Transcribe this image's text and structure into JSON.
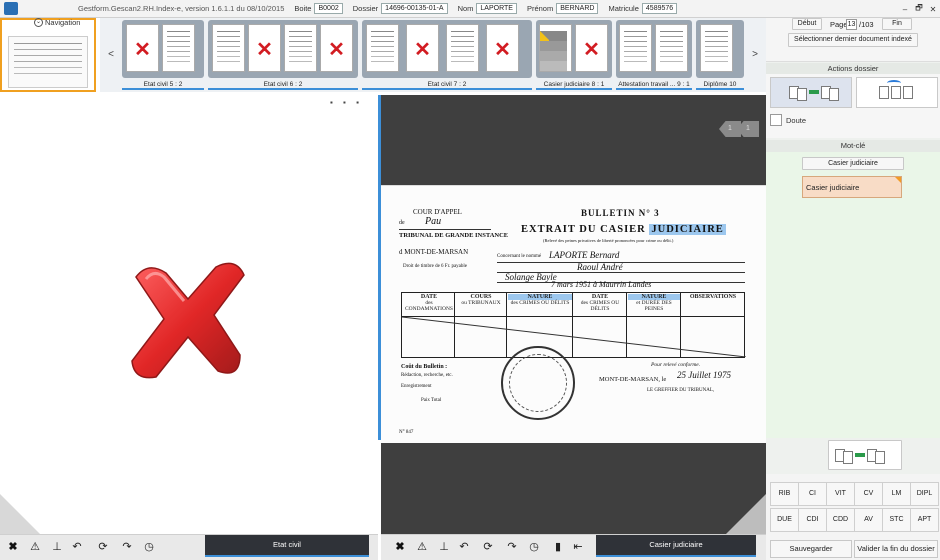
{
  "window": {
    "title": "Gestform.Gescan2.RH.Index-e, version 1.6.1.1 du 08/10/2015",
    "fields": [
      {
        "label": "Boite",
        "value": "B0002"
      },
      {
        "label": "Dossier",
        "value": "14696-00135-01-A"
      },
      {
        "label": "Nom",
        "value": "LAPORTE"
      },
      {
        "label": "Prénom",
        "value": "BERNARD"
      },
      {
        "label": "Matricule",
        "value": "4589576"
      }
    ],
    "controls": [
      "–",
      "🗗",
      "✕"
    ]
  },
  "navigation": {
    "toggle_label": "Navigation",
    "prev": "<",
    "next": ">"
  },
  "strip_groups": [
    {
      "label": "Etat civil 5 : 2"
    },
    {
      "label": "Etat civil 6 : 2"
    },
    {
      "label": "Etat civil 7 : 2"
    },
    {
      "label": "Casier judiciaire 8 : 1"
    },
    {
      "label": "Attestation travail ... 9 : 1"
    },
    {
      "label": "Diplôme 10"
    }
  ],
  "doc_pane": {
    "badges": [
      "1",
      "1"
    ],
    "doc": {
      "cour": "COUR D'APPEL",
      "de": "de",
      "pau": "Pau",
      "tribunal": "TRIBUNAL DE GRANDE INSTANCE",
      "mont": "d MONT-DE-MARSAN",
      "bulletin": "BULLETIN N° 3",
      "extrait": "EXTRAIT DU CASIER",
      "judiciaire": "JUDICIAIRE",
      "sub": "(Relevé des peines privatives de liberté prononcées pour crime ou délit.)",
      "concernant": "Concernant le nommé",
      "name_hw": "LAPORTE Bernard",
      "fils_hw": "Raoul André",
      "mere_hw": "Solange Bayle",
      "date_hw": "7 mars 1951 à Maurrin Landes",
      "droit": "Droit de timbre de 6 Fr. payable",
      "table_headers": [
        "DATE",
        "COURS",
        "NATURE",
        "DATE",
        "NATURE",
        "OBSERVATIONS"
      ],
      "table_subs": [
        "des CONDAMNATIONS",
        "ou TRIBUNAUX",
        "des CRIMES OU DÉLITS",
        "des CRIMES OU DÉLITS",
        "et DURÉE DES PEINES",
        ""
      ],
      "cout": "Coût du Bulletin :",
      "redaction": "Rédaction, recherche, etc.",
      "enregistrement": "Enregistrement",
      "paix": "Paix Total",
      "certifie": "Pour relevé conforme.",
      "lieu": "MONT-DE-MARSAN, le",
      "date_sign": "25 Juillet 1975",
      "greffier": "LE GREFFIER DU TRIBUNAL,",
      "num": "N° 847"
    }
  },
  "sidebar": {
    "debut": "Début",
    "page_label": "Page",
    "page_value": "13",
    "page_total": "/103",
    "fin": "Fin",
    "select_last": "Sélectionner dernier document indexé",
    "actions_title": "Actions dossier",
    "doute": "Doute",
    "keyword_title": "Mot-clé",
    "keyword_button": "Casier judiciaire",
    "keyword_chip": "Casier judiciaire",
    "doc_types": [
      "RIB",
      "CI",
      "VIT",
      "CV",
      "LM",
      "DIPL",
      "DUE",
      "CDI",
      "CDD",
      "AV",
      "STC",
      "APT"
    ],
    "save": "Sauvegarder",
    "validate": "Valider la fin du dossier"
  },
  "bottom": {
    "left_tab": "Etat civil",
    "right_tab": "Casier judiciaire"
  },
  "colors": {
    "accent": "#3c8fd8",
    "x_red": "#d21c22",
    "selected_orange": "#f0a020"
  }
}
